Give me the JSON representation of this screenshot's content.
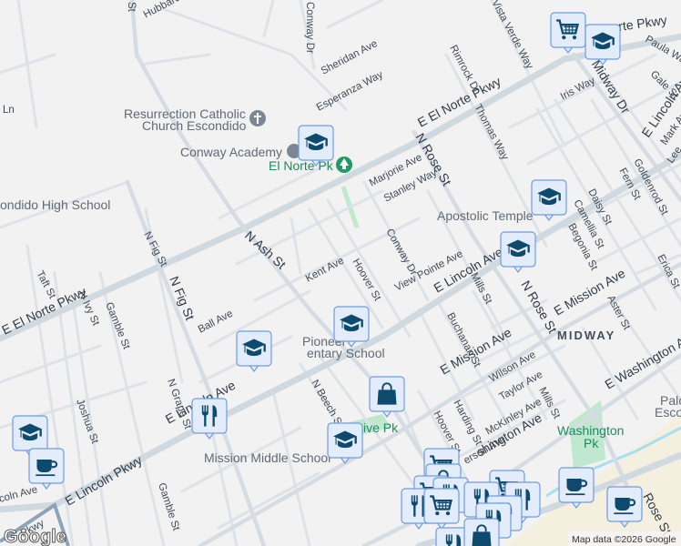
{
  "map": {
    "pois": {
      "church": [
        "Resurrection Catholic",
        "Church Escondido"
      ],
      "conway_academy": "Conway Academy",
      "el_norte_park": "El Norte Pk",
      "high_school": "ondido High School",
      "apostolic_temple": "Apostolic Temple",
      "pioneer_school": [
        "Pioneer",
        "entary School"
      ],
      "mission_middle": "Mission Middle School",
      "washington_park": [
        "Washington",
        "Pk"
      ],
      "grove_park": "ive Pk",
      "palo": [
        "Palo",
        "Esco"
      ],
      "neighborhood": "MIDWAY"
    },
    "streets": {
      "hubbard": "Hubbard Ave",
      "st_top": "St",
      "conway_top": "Conway Dr",
      "sheridan": "Sheridan Ave",
      "esperanza": "Esperanza Way",
      "ln": "Ln",
      "el_norte_main": "E El Norte Pkwy",
      "el_norte_ne": "rte Pkwy",
      "rimrock": "Rimrock Dr",
      "vista_verde": "Vista Verde Way",
      "thomas": "Thomas Way",
      "rose_n": "N Rose St",
      "marjorie": "Marjorie Ave",
      "stanley": "Stanley Way",
      "iris": "Iris Way",
      "midway": "N Midway Dr",
      "paula": "Paula Way",
      "gale": "Gale St",
      "lincoln_ne": "E Lincoln Av",
      "mark": "Mark Av",
      "lee": "Lee",
      "goldenrod": "Goldenrod St",
      "fern": "Fern St",
      "daisy": "Daisy St",
      "camellia": "Camellia St",
      "begonia": "Begonia St",
      "aster": "Aster St",
      "erica": "Erica St",
      "ash": "N Ash St",
      "fig1": "N Fig St",
      "fig2": "N Fig St",
      "kent": "Kent Ave",
      "hoover1": "Hoover St",
      "conway2": "Conway Dr",
      "view_pointe": "View Pointe Ave",
      "lincoln_mid": "E Lincoln Ave",
      "mills1": "Mills St",
      "rose_mid": "N Rose St",
      "mission_e": "E Mission Ave",
      "mission_w": "E Mission Ave",
      "washington_e": "E Washington Ave",
      "washington_w": "shington Ave",
      "buchanan": "Buchanan St",
      "wilson": "Wilson Ave",
      "taylor": "Taylor Ave",
      "mckinley": "McKinley Ave",
      "hoover2": "Hoover St",
      "harding": "Harding St",
      "mills2": "Mills St",
      "jefferson": "erson Ave",
      "taft": "Taft St",
      "ivy": "N Ivy St",
      "gamble1": "Gamble St",
      "gamble2": "Gamble St",
      "el_norte_w": "E El Norte Pkwy",
      "ball": "Ball Ave",
      "joshua": "Joshua St",
      "grape": "N Grape St",
      "lincoln_w": "E Lincoln Ave",
      "lincoln_pkwy": "E Lincoln Pkwy",
      "lincoln_far": "coln Ave",
      "pkwy_sw": "Pkwy",
      "beech": "N Beech St",
      "rose_s": "Rose St"
    },
    "markers": [
      {
        "type": "shopping-cart"
      },
      {
        "type": "school"
      },
      {
        "type": "school"
      },
      {
        "type": "school"
      },
      {
        "type": "school"
      },
      {
        "type": "school"
      },
      {
        "type": "school"
      },
      {
        "type": "restaurant"
      },
      {
        "type": "school"
      },
      {
        "type": "cafe"
      },
      {
        "type": "shopping-bag"
      },
      {
        "type": "school"
      },
      {
        "type": "cafe"
      },
      {
        "type": "cafe"
      }
    ],
    "colors": {
      "marker_fill": "#e3ecfb",
      "marker_border": "#6f9be0",
      "icon": "#0d4a6e",
      "park": "#bfe8cf",
      "commercial": "#f5efe0"
    },
    "logo": "Google",
    "attribution": "Map data ©2026 Google"
  }
}
